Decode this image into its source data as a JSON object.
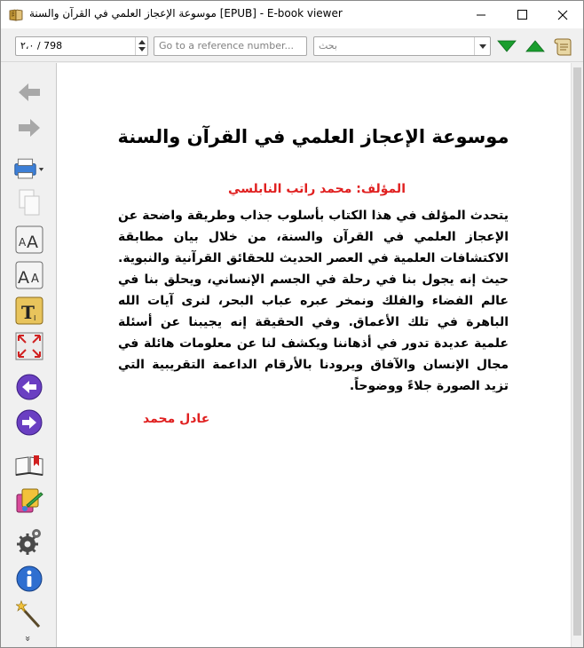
{
  "window": {
    "title": "موسوعة الإعجاز العلمي في القرآن والسنة [EPUB] - E-book viewer",
    "app_icon": "ebook-viewer-icon",
    "controls": {
      "minimize": "minimize-icon",
      "maximize": "maximize-icon",
      "close": "close-icon"
    }
  },
  "toolbar": {
    "position_value": "٢،٠ / 798",
    "reference_placeholder": "Go to a reference number...",
    "search_placeholder": "بحث",
    "icons": [
      "find-next-icon",
      "find-previous-icon",
      "toc-scroll-icon"
    ],
    "accent_green": "#1a9e2e"
  },
  "sidebar": {
    "icons": [
      "back-arrow-icon",
      "forward-arrow-icon",
      "print-icon",
      "copy-icon",
      "font-size-increase-icon",
      "font-size-decrease-icon",
      "text-style-icon",
      "fullscreen-icon",
      "previous-page-icon",
      "next-page-icon",
      "bookmarks-icon",
      "reference-mode-icon",
      "preferences-gear-icon",
      "info-icon",
      "magic-wand-icon"
    ],
    "more_glyph": "»"
  },
  "document": {
    "title": "موسوعة الإعجاز العلمي في القرآن والسنة",
    "author_line": "المؤلف: محمد راتب النابلسي",
    "body": "يتحدث المؤلف في هذا الكتاب بأسلوب جذاب وطريقة واضحة عن الإعجاز العلمي في القرآن والسنة، من خلال بيان مطابقة الاكتشافات العلمية في العصر الحديث للحقائق القرآنية والنبوية. حيث إنه يجول بنا في رحلة في الجسم الإنساني، ويحلق بنا في عالم الفضاء والفلك ونمخر عبره عباب البحر، لنرى آيات الله الباهرة في تلك الأعماق. وفي الحقيقة إنه يجيبنا عن أسئلة علمية عديدة تدور في أذهاننا ويكشف لنا عن معلومات هائلة في مجال الإنسان والآفاق ويرودنا بالأرقام الداعمة التقريبية التي تزيد الصورة جلاءً ووضوحاً.",
    "signature": "عادل محمد",
    "accent_red": "#e02020"
  }
}
